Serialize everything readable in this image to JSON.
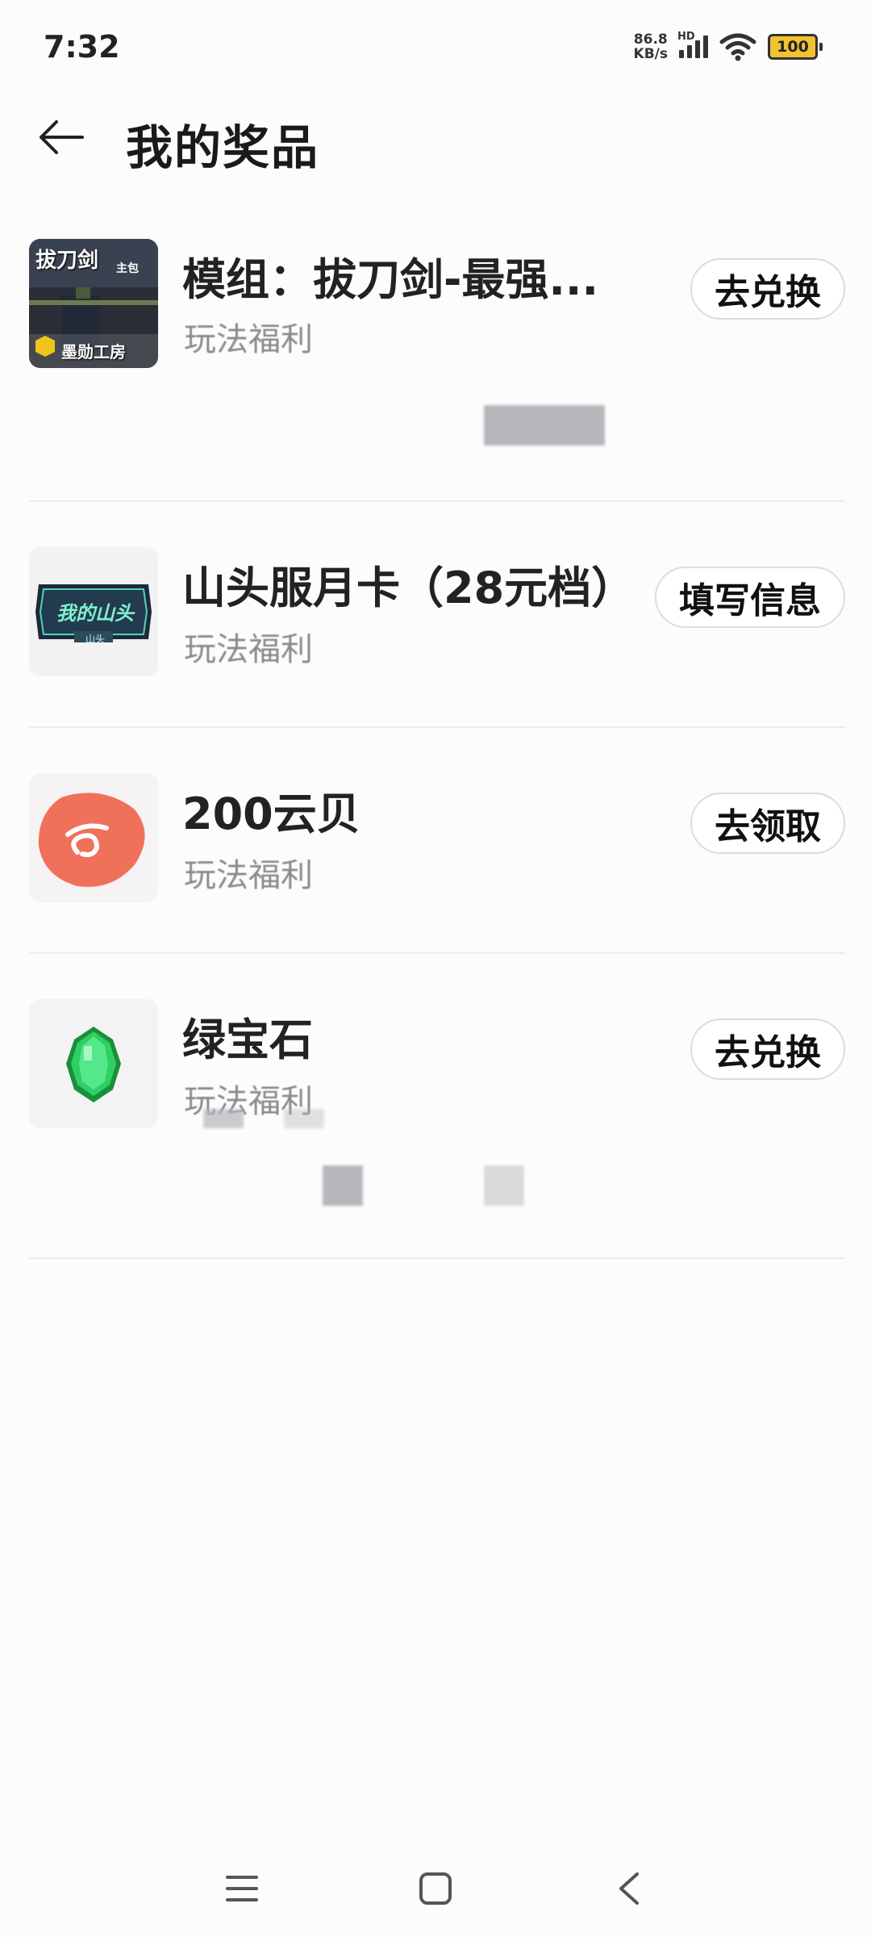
{
  "status_bar": {
    "time": "7:32",
    "net_speed_value": "86.8",
    "net_speed_unit": "KB/s",
    "hd_label": "HD",
    "battery_level": "100",
    "battery_color": "#f1c232"
  },
  "header": {
    "title": "我的奖品",
    "back_icon": "arrow-left-icon"
  },
  "prizes": [
    {
      "name": "模组：拔刀剑-最强...",
      "subtitle": "玩法福利",
      "action": "去兑换",
      "thumb_text_top": "拔刀剑",
      "thumb_text_tag": "主包",
      "thumb_text_studio": "墨勋工房"
    },
    {
      "name": "山头服月卡（28元档）",
      "subtitle": "玩法福利",
      "action": "填写信息",
      "thumb_text_main": "我的山头",
      "thumb_text_small": "山头"
    },
    {
      "name": "200云贝",
      "subtitle": "玩法福利",
      "action": "去领取",
      "thumb_icon": "cloud-coin-icon"
    },
    {
      "name": "绿宝石",
      "subtitle": "玩法福利",
      "action": "去兑换",
      "thumb_icon": "emerald-icon"
    }
  ],
  "nav_bar": {
    "menu_icon": "menu-icon",
    "home_icon": "home-square-icon",
    "back_icon": "back-chevron-icon"
  }
}
